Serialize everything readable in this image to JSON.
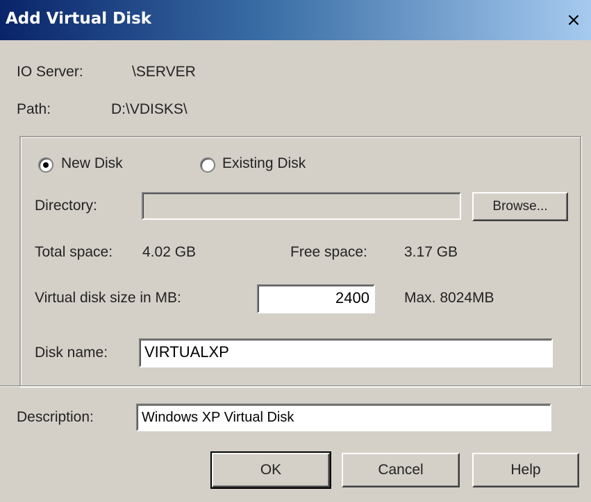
{
  "window": {
    "title": "Add Virtual Disk",
    "close_glyph": "×"
  },
  "info": {
    "io_server_label": "IO Server:",
    "io_server_value": "\\SERVER",
    "path_label": "Path:",
    "path_value": "D:\\VDISKS\\"
  },
  "disk_type": {
    "new_disk_label": "New Disk",
    "existing_disk_label": "Existing Disk",
    "selected": "New Disk"
  },
  "directory": {
    "label": "Directory:",
    "value": "",
    "browse_label": "Browse..."
  },
  "space": {
    "total_label": "Total space:",
    "total_value": "4.02 GB",
    "free_label": "Free space:",
    "free_value": "3.17 GB"
  },
  "size": {
    "label": "Virtual disk size in MB:",
    "value": "2400",
    "max_label": "Max. 8024MB"
  },
  "disk_name": {
    "label": "Disk name:",
    "value": "VIRTUALXP"
  },
  "description": {
    "label": "Description:",
    "value": "Windows XP Virtual Disk"
  },
  "buttons": {
    "ok": "OK",
    "cancel": "Cancel",
    "help": "Help"
  },
  "colors": {
    "titlebar_start": "#0a246a",
    "titlebar_end": "#a6caf0",
    "dialog_bg": "#d4d0c8"
  }
}
